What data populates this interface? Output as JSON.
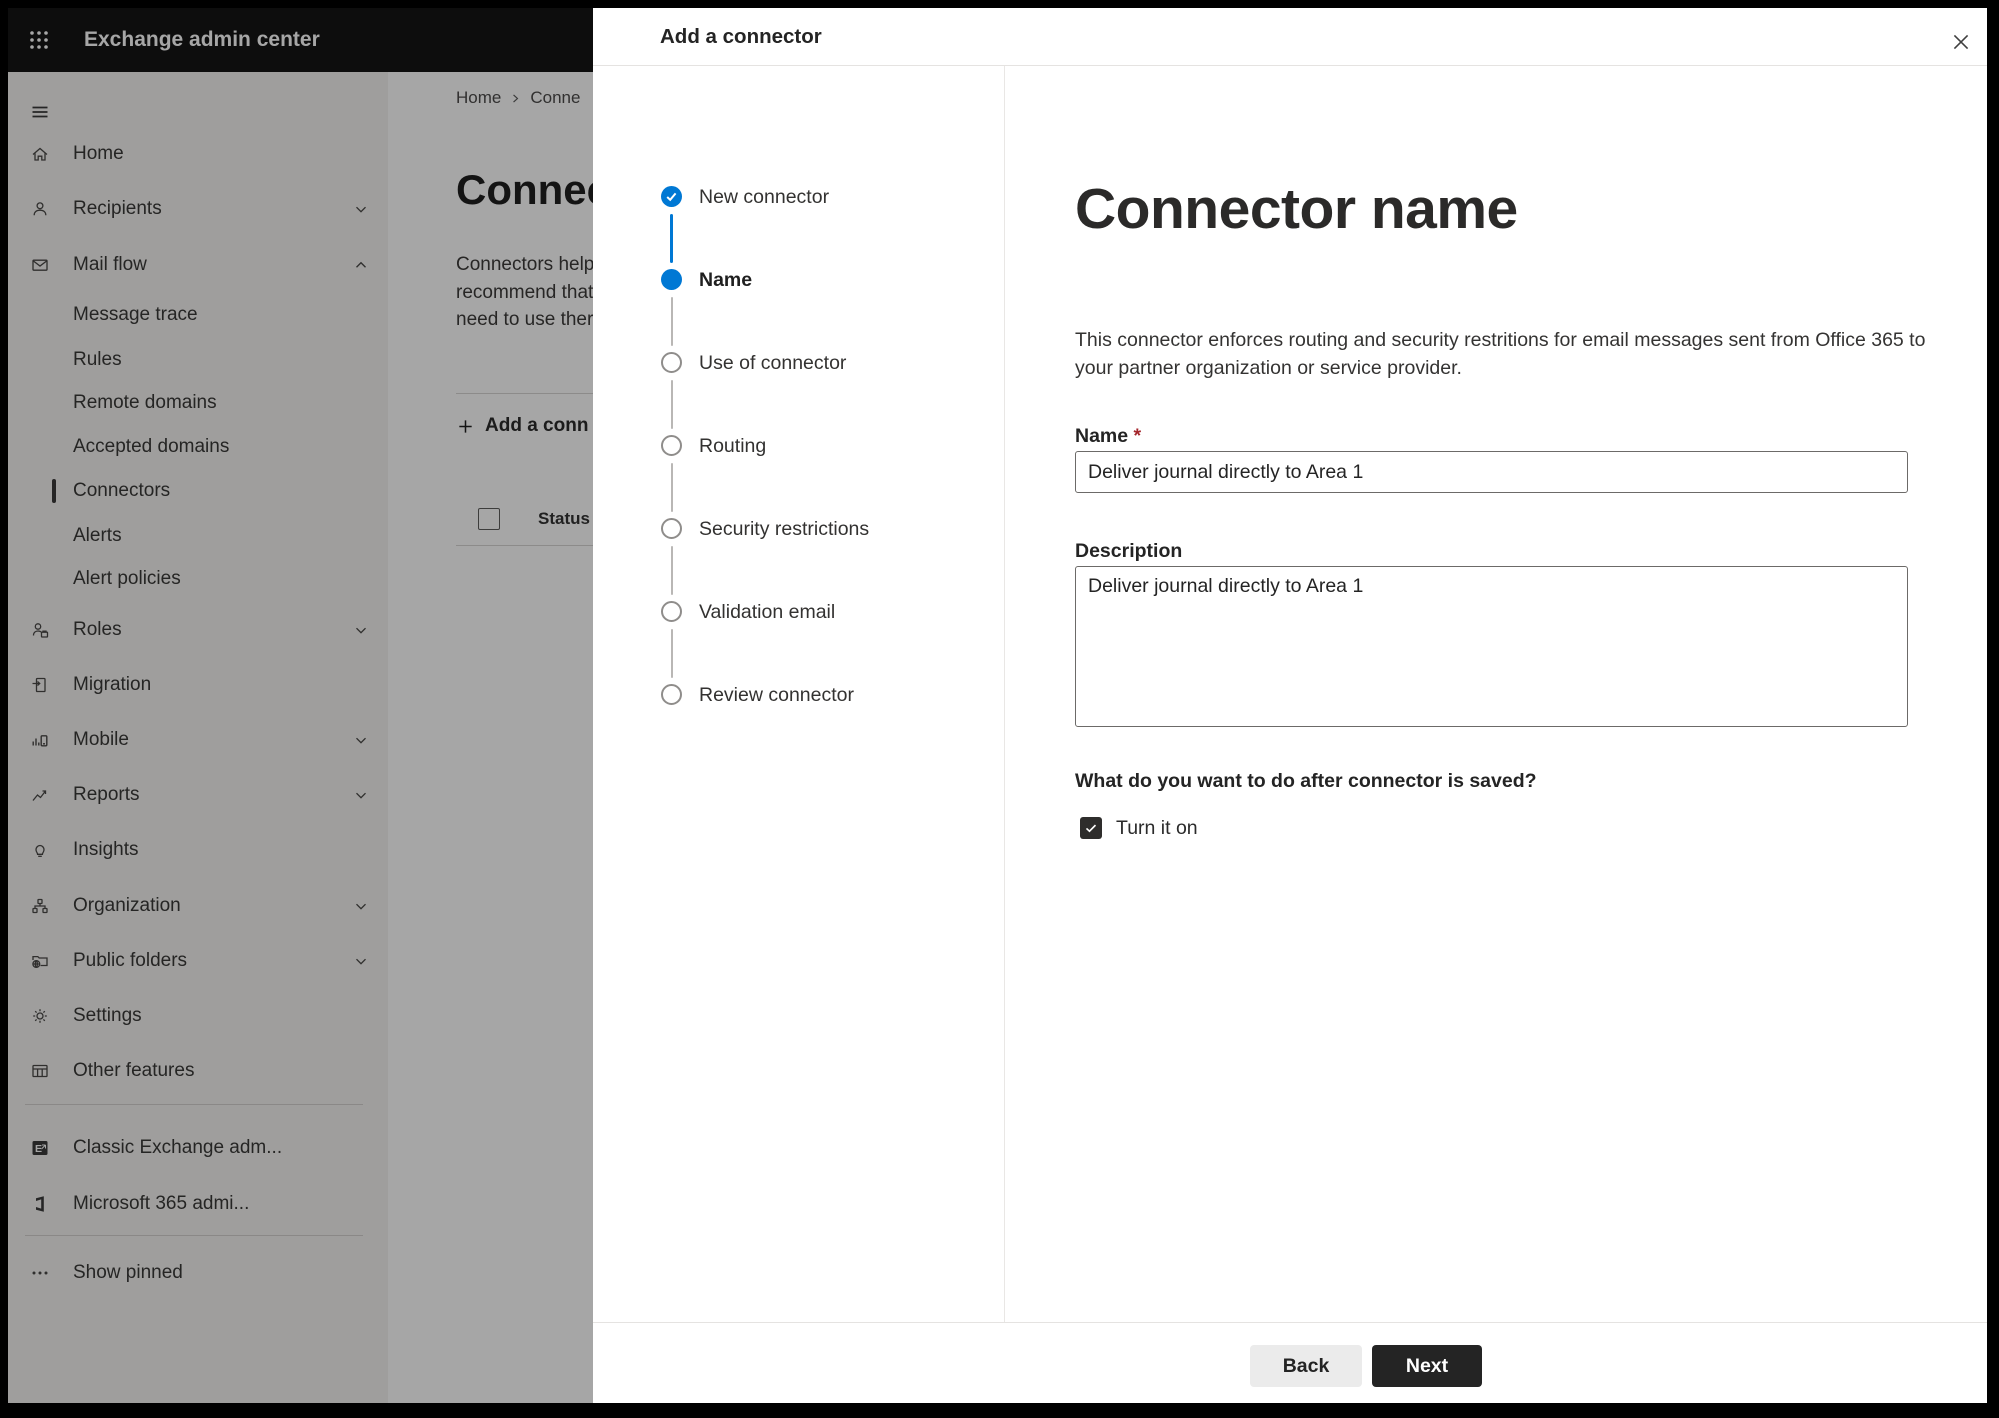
{
  "header": {
    "title": "Exchange admin center"
  },
  "sidebar": {
    "items": [
      {
        "label": "Home",
        "icon": "home-icon"
      },
      {
        "label": "Recipients",
        "icon": "person-icon",
        "chevron": "down"
      },
      {
        "label": "Mail flow",
        "icon": "mail-icon",
        "chevron": "up",
        "expanded": true
      },
      {
        "label": "Message trace",
        "sub": true
      },
      {
        "label": "Rules",
        "sub": true
      },
      {
        "label": "Remote domains",
        "sub": true
      },
      {
        "label": "Accepted domains",
        "sub": true
      },
      {
        "label": "Connectors",
        "sub": true,
        "selected": true
      },
      {
        "label": "Alerts",
        "sub": true
      },
      {
        "label": "Alert policies",
        "sub": true
      },
      {
        "label": "Roles",
        "icon": "roles-icon",
        "chevron": "down"
      },
      {
        "label": "Migration",
        "icon": "migration-icon"
      },
      {
        "label": "Mobile",
        "icon": "mobile-icon",
        "chevron": "down"
      },
      {
        "label": "Reports",
        "icon": "reports-icon",
        "chevron": "down"
      },
      {
        "label": "Insights",
        "icon": "insights-icon"
      },
      {
        "label": "Organization",
        "icon": "organization-icon",
        "chevron": "down"
      },
      {
        "label": "Public folders",
        "icon": "public-folders-icon",
        "chevron": "down"
      },
      {
        "label": "Settings",
        "icon": "settings-icon"
      },
      {
        "label": "Other features",
        "icon": "other-features-icon"
      }
    ],
    "footer_items": [
      {
        "label": "Classic Exchange adm...",
        "icon": "classic-exchange-icon"
      },
      {
        "label": "Microsoft 365 admi...",
        "icon": "microsoft-365-icon"
      }
    ],
    "show_pinned": "Show pinned"
  },
  "background_page": {
    "breadcrumb": {
      "home": "Home",
      "current": "Conne"
    },
    "title": "Connec",
    "description_lines": [
      "Connectors help",
      "recommend that",
      "need to use ther"
    ],
    "add_button": "Add a conn",
    "status_column": "Status"
  },
  "dialog": {
    "title": "Add a connector",
    "steps": [
      {
        "label": "New connector",
        "state": "done"
      },
      {
        "label": "Name",
        "state": "current"
      },
      {
        "label": "Use of connector",
        "state": "todo"
      },
      {
        "label": "Routing",
        "state": "todo"
      },
      {
        "label": "Security restrictions",
        "state": "todo"
      },
      {
        "label": "Validation email",
        "state": "todo"
      },
      {
        "label": "Review connector",
        "state": "todo"
      }
    ],
    "content": {
      "heading": "Connector name",
      "intro": "This connector enforces routing and security restritions for email messages sent from Office 365 to your partner organization or service provider.",
      "name_label": "Name",
      "required_marker": "*",
      "name_value": "Deliver journal directly to Area 1",
      "description_label": "Description",
      "description_value": "Deliver journal directly to Area 1",
      "question": "What do you want to do after connector is saved?",
      "checkbox_label": "Turn it on",
      "checkbox_checked": true
    },
    "footer": {
      "back_label": "Back",
      "next_label": "Next"
    }
  },
  "colors": {
    "accent_blue": "#0078d4",
    "topbar_bg": "#151515",
    "sidebar_bg": "#f4f3f1",
    "overlay": "rgba(0,0,0,0.35)",
    "primary_button_bg": "#242424",
    "required_red": "#a4262c",
    "step_pending_gray": "#8f8d8b"
  }
}
